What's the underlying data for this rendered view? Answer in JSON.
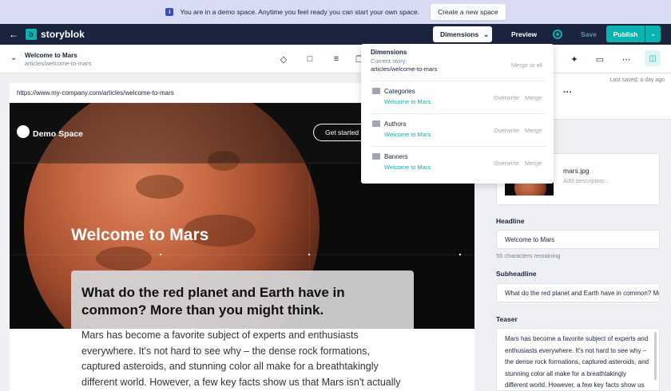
{
  "banner": {
    "message": "You are in a demo space. Anytime you feel ready you can start your own space.",
    "button": "Create a new space",
    "info_icon": "info-icon"
  },
  "topbar": {
    "brand": "storyblok",
    "dimensions_button": "Dimensions",
    "preview_button": "Preview",
    "save_button": "Save",
    "publish_button": "Publish",
    "accent_color": "#09b3af",
    "background_color": "#1b243f"
  },
  "story": {
    "title": "Welcome to Mars",
    "path": "articles/welcome-to-mars"
  },
  "preview": {
    "url": "https://www.my-company.com/articles/welcome-to-mars",
    "site_name": "Demo Space",
    "cta": "Get started",
    "hero_title": "Welcome to Mars",
    "teaser_heading": "What do the red planet and Earth have in common? More than you might think.",
    "body": "Mars has become a favorite subject of experts and enthusiasts everywhere. It's not hard to see why – the dense rock formations, captured asteroids, and stunning color all make for a breathtakingly different world. However, a few key facts show us that Mars isn't actually that different from our own."
  },
  "panel": {
    "last_saved": "Last saved: a day ago",
    "asset_name": "mars.jpg",
    "asset_description_placeholder": "Add description...",
    "headline_label": "Headline",
    "headline_value": "Welcome to Mars",
    "headline_help": "55 characters remaining",
    "subheadline_label": "Subheadline",
    "subheadline_value": "What do the red planet and Earth have in common? More than you might think.",
    "teaser_label": "Teaser",
    "teaser_value": "Mars has become a favorite subject of experts and enthusiasts everywhere. It's not hard to see why – the dense rock formations, captured asteroids, and stunning color all make for a breathtakingly different world. However, a few key facts show us that Mars isn't actually that different from our own."
  },
  "dimensions_menu": {
    "title": "Dimensions",
    "subtitle": "Current story:",
    "current_path": "articles/welcome-to-mars",
    "merge_all": "Merge to all",
    "overwrite": "Overwrite",
    "merge": "Merge",
    "items": [
      {
        "name": "Categories",
        "story": "Welcome to Mars"
      },
      {
        "name": "Authors",
        "story": "Welcome to Mars"
      },
      {
        "name": "Banners",
        "story": "Welcome to Mars"
      }
    ]
  }
}
